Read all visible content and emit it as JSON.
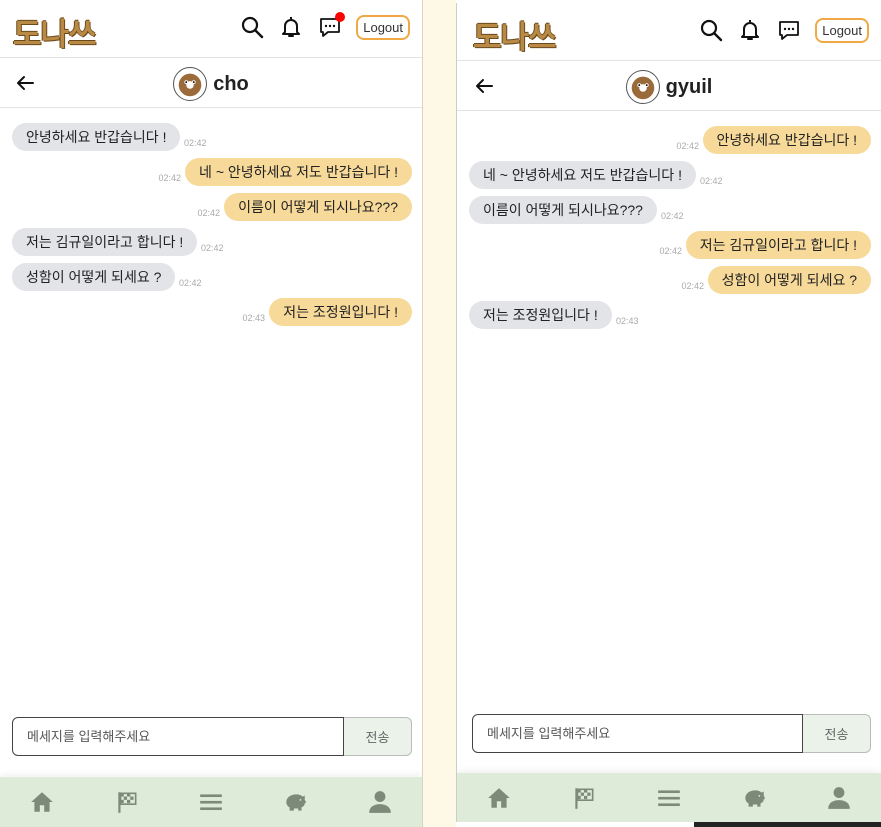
{
  "app": {
    "logo_text": "도나쓰",
    "logout_label": "Logout"
  },
  "panes": [
    {
      "peer_name": "cho",
      "messages": [
        {
          "dir": "in",
          "text": "안녕하세요 반갑습니다 !",
          "time": "02:42"
        },
        {
          "dir": "out",
          "text": "네 ~ 안녕하세요 저도 반갑습니다 !",
          "time": "02:42"
        },
        {
          "dir": "out",
          "text": "이름이 어떻게 되시나요???",
          "time": "02:42"
        },
        {
          "dir": "in",
          "text": "저는 김규일이라고 합니다 !",
          "time": "02:42"
        },
        {
          "dir": "in",
          "text": "성함이 어떻게 되세요 ?",
          "time": "02:42"
        },
        {
          "dir": "out",
          "text": "저는 조정원입니다 !",
          "time": "02:43"
        }
      ],
      "input_placeholder": "메세지를 입력해주세요",
      "send_label": "전송",
      "has_chat_notification": true
    },
    {
      "peer_name": "gyuil",
      "messages": [
        {
          "dir": "out",
          "text": "안녕하세요 반갑습니다 !",
          "time": "02:42"
        },
        {
          "dir": "in",
          "text": "네 ~ 안녕하세요 저도 반갑습니다 !",
          "time": "02:42"
        },
        {
          "dir": "in",
          "text": "이름이 어떻게 되시나요???",
          "time": "02:42"
        },
        {
          "dir": "out",
          "text": "저는 김규일이라고 합니다 !",
          "time": "02:42"
        },
        {
          "dir": "out",
          "text": "성함이 어떻게 되세요 ?",
          "time": "02:42"
        },
        {
          "dir": "in",
          "text": "저는 조정원입니다 !",
          "time": "02:43"
        }
      ],
      "input_placeholder": "메세지를 입력해주세요",
      "send_label": "전송",
      "has_chat_notification": false
    }
  ],
  "bottom_nav": [
    "home-icon",
    "flag-icon",
    "menu-icon",
    "piggy-bank-icon",
    "user-icon"
  ],
  "colors": {
    "incoming_bubble": "#e3e4e8",
    "outgoing_bubble": "#f7d99a",
    "nav_background": "#deebd8",
    "logout_border": "#f0a945",
    "notification_dot": "#ff0000"
  }
}
